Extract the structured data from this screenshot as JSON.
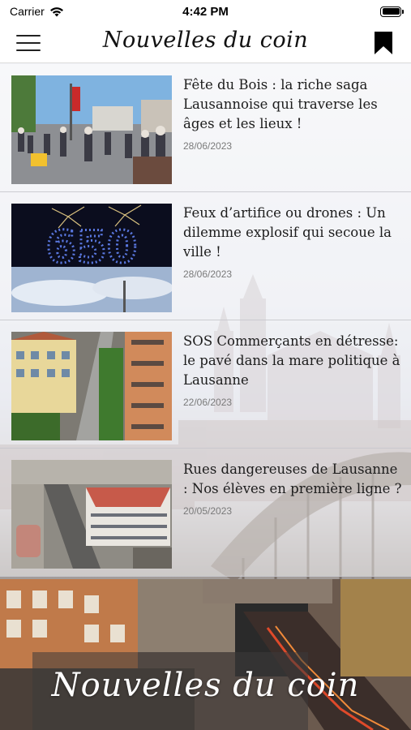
{
  "status_bar": {
    "carrier": "Carrier",
    "time": "4:42 PM",
    "wifi_icon": "wifi-icon",
    "battery_icon": "battery-icon"
  },
  "header": {
    "title": "Nouvelles du coin",
    "menu_icon": "hamburger-menu-icon",
    "bookmark_icon": "bookmark-icon"
  },
  "articles": [
    {
      "title": "Fête du Bois : la riche saga Lausannoise qui traverse les âges et les lieux !",
      "date": "28/06/2023",
      "image": "street-festival-parade"
    },
    {
      "title": "Feux d’artifice ou drones : Un dilemme explosif qui secoue la ville !",
      "date": "28/06/2023",
      "image": "fireworks-650-drones"
    },
    {
      "title": "SOS Commerçants en détresse: le pavé dans la mare politique à Lausanne",
      "date": "22/06/2023",
      "image": "aerial-street-lausanne"
    },
    {
      "title": "Rues dangereuses de Lausanne : Nos élèves en première ligne ?",
      "date": "20/05/2023",
      "image": "aerial-school-buildings"
    }
  ],
  "footer": {
    "title": "Nouvelles du coin"
  },
  "colors": {
    "header_bg": "#ffffff",
    "title_text": "#1c1c1c",
    "date_text": "#7a7a7a",
    "divider": "#c8c8cd"
  }
}
